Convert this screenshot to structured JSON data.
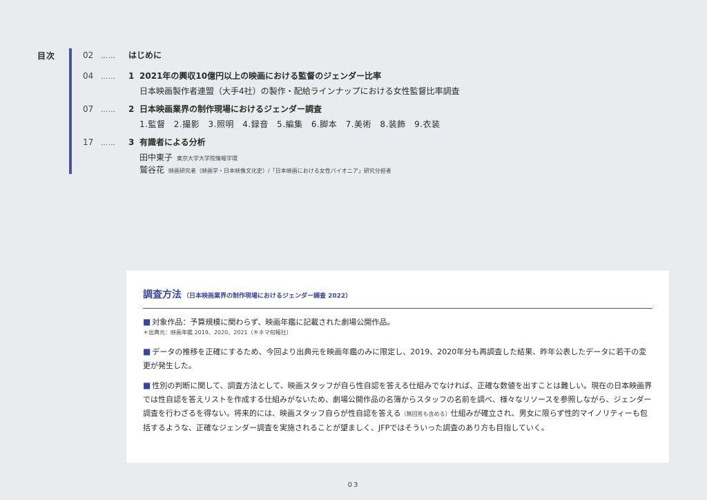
{
  "toc": {
    "label": "目次",
    "entries": [
      {
        "page": "02",
        "dots": "……",
        "num": "",
        "title": "はじめに",
        "subs": []
      },
      {
        "page": "04",
        "dots": "……",
        "num": "1",
        "title": "2021年の興収10億円以上の映画における監督のジェンダー比率",
        "subs": [
          "日本映画製作者連盟（大手4社）の製作・配給ラインナップにおける女性監督比率調査"
        ]
      },
      {
        "page": "07",
        "dots": "……",
        "num": "2",
        "title": "日本映画業界の制作現場におけるジェンダー調査",
        "subs": [
          "1.監督 2.撮影 3.照明 4.録音 5.編集 6.脚本 7.美術 8.装飾 9.衣装"
        ]
      },
      {
        "page": "17",
        "dots": "……",
        "num": "3",
        "title": "有識者による分析",
        "people": [
          {
            "name": "田中東子",
            "role": "東京大学大学院情報学環"
          },
          {
            "name": "鷲谷花",
            "role": "映画研究者（映画学・日本映像文化史）/「日本映画における女性パイオニア」研究分担者"
          }
        ]
      }
    ]
  },
  "method": {
    "title": "調査方法",
    "title_sub": "（日本映画業界の制作現場におけるジェンダー調査 2022）",
    "bullet": "■",
    "p1": "対象作品：予算規模に関わらず、映画年鑑に記載された劇場公開作品。",
    "p1_note": "＊出典元：映画年鑑 2019、2020、2021（キネマ旬報社）",
    "p2": "データの推移を正確にするため、今回より出典元を映画年鑑のみに限定し、2019、2020年分も再調査した結果、昨年公表したデータに若干の変更が発生した。",
    "p3_a": "性別の判断に関して、調査方法として、映画スタッフが自ら性自認を答える仕組みでなければ、正確な数値を出すことは難しい。現在の日本映画界では性自認を答えリストを作成する仕組みがないため、劇場公開作品の名簿からスタッフの名前を調べ、様々なリソースを参照しながら、ジェンダー調査を行わざるを得ない。将来的には、映画スタッフ自らが性自認を答える",
    "p3_paren": "（無回答も含める）",
    "p3_b": "仕組みが確立され、男女に限らず性的マイノリティーも包括するような、正確なジェンダー調査を実施されることが望ましく、JFPではそういった調査のあり方も目指していく。"
  },
  "page_number": "03",
  "colors": {
    "accent": "#3a4699",
    "bar": "#4a53a0",
    "background": "#e9ecee"
  }
}
